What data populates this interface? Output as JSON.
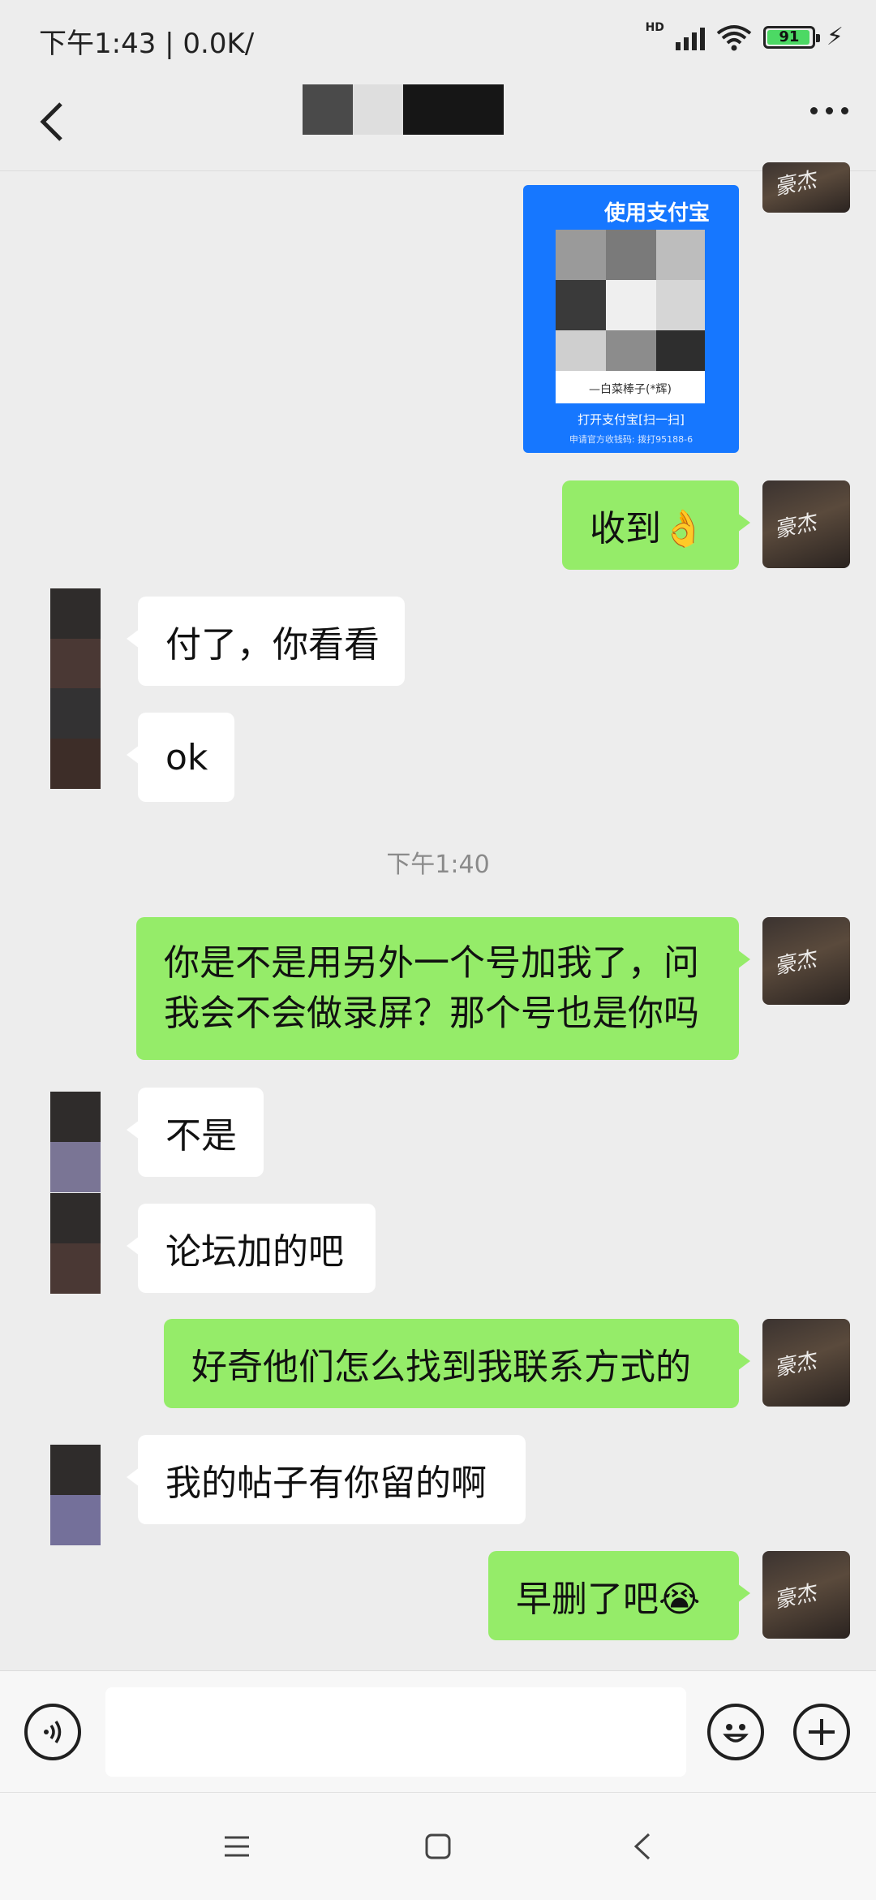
{
  "status_bar": {
    "time_speed": "下午1:43 | 0.0K/",
    "network": "HD",
    "battery": "91"
  },
  "header": {
    "title": ""
  },
  "qr_card": {
    "title": "使用支付宝",
    "caption": "—白菜棒子(*辉)",
    "bottom": "打开支付宝[扫一扫]",
    "footer": "申请官方收钱码: 拨打95188-6"
  },
  "messages": [
    {
      "from": "me",
      "text": "收到👌"
    },
    {
      "from": "other",
      "text": "付了，你看看"
    },
    {
      "from": "other",
      "text": "ok"
    },
    {
      "from": "me",
      "text": "你是不是用另外一个号加我了，问我会不会做录屏？那个号也是你吗"
    },
    {
      "from": "other",
      "text": "不是"
    },
    {
      "from": "other",
      "text": "论坛加的吧"
    },
    {
      "from": "me",
      "text": "好奇他们怎么找到我联系方式的"
    },
    {
      "from": "other",
      "text": "我的帖子有你留的啊"
    },
    {
      "from": "me",
      "text": "早删了吧😭"
    }
  ],
  "timestamp": "下午1:40",
  "avatar_me": {
    "signature": "豪杰"
  },
  "input": {
    "placeholder": ""
  },
  "colors": {
    "bubble_out": "#95ec69",
    "bubble_in": "#ffffff",
    "background": "#ededed",
    "alipay_blue": "#1677ff"
  },
  "icons": {
    "voice": "voice-icon",
    "emoji": "emoji-icon",
    "plus": "plus-icon",
    "back": "chevron-left-icon",
    "more": "more-icon"
  }
}
